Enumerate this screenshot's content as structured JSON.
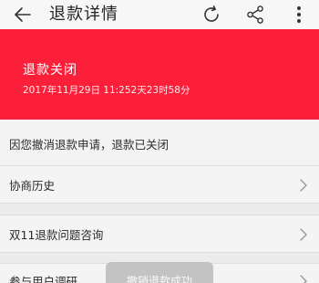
{
  "header": {
    "title": "退款详情",
    "back_icon": "back-arrow-icon",
    "refresh_icon": "refresh-icon",
    "share_icon": "share-icon",
    "more_icon": "more-vertical-icon",
    "background": "#f7f7f7"
  },
  "banner": {
    "status": "退款关闭",
    "datetime": "2017年11月29日 11:252天23时58分",
    "background": "#fc1f3a"
  },
  "notice": {
    "text": "因您撤消退款申请，退款已关闭"
  },
  "menu": {
    "history_label": "协商历史",
    "consult_label": "双11退款问题咨询",
    "survey_label": "参与用户调研",
    "chevron_icon": "chevron-right-icon"
  },
  "toast": {
    "text": "撤销退款成功"
  }
}
